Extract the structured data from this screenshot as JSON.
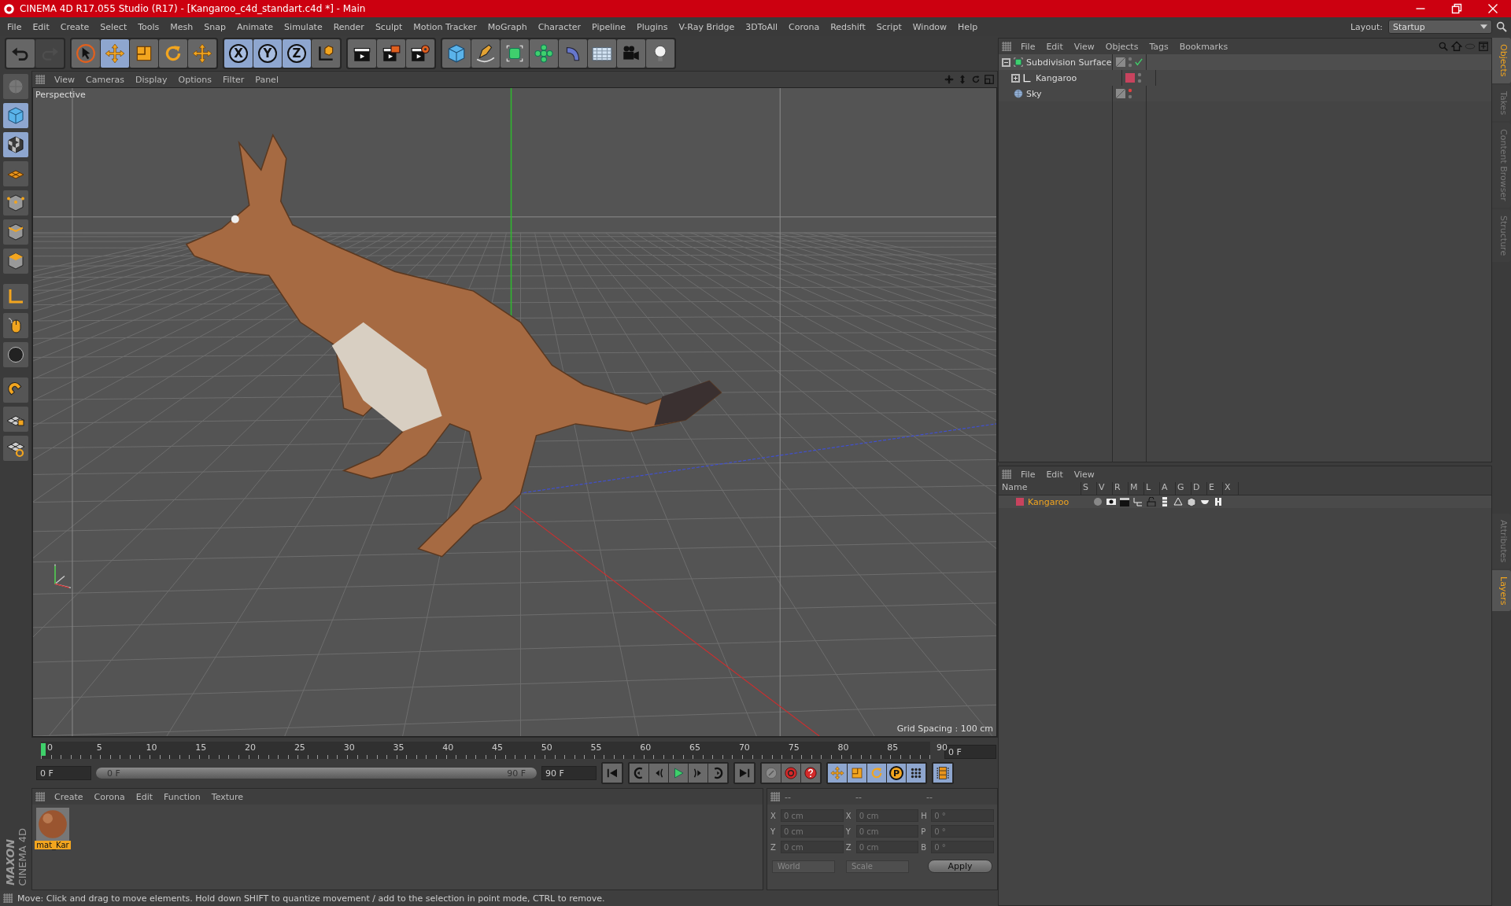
{
  "window": {
    "title": "CINEMA 4D R17.055 Studio (R17) - [Kangaroo_c4d_standart.c4d *] - Main"
  },
  "menu": [
    "File",
    "Edit",
    "Create",
    "Select",
    "Tools",
    "Mesh",
    "Snap",
    "Animate",
    "Simulate",
    "Render",
    "Sculpt",
    "Motion Tracker",
    "MoGraph",
    "Character",
    "Pipeline",
    "Plugins",
    "V-Ray Bridge",
    "3DToAll",
    "Corona",
    "Redshift",
    "Script",
    "Window",
    "Help"
  ],
  "layout": {
    "label": "Layout:",
    "value": "Startup"
  },
  "toolbar": {
    "history": [
      {
        "disabled": false
      },
      {
        "disabled": true
      }
    ],
    "tools": [
      {
        "selected": false
      },
      {
        "selected": true
      },
      {
        "selected": false
      },
      {
        "selected": false
      },
      {
        "selected": false
      }
    ],
    "axes": [
      {
        "label": "X",
        "selected": true
      },
      {
        "label": "Y",
        "selected": true
      },
      {
        "label": "Z",
        "selected": true
      }
    ]
  },
  "left_tools": [
    {
      "selected": false
    },
    {
      "selected": true
    },
    {
      "selected": true
    },
    {
      "selected": false
    },
    {
      "selected": false
    },
    {
      "selected": false
    },
    {
      "selected": false
    },
    {
      "selected": false
    },
    {
      "selected": false
    },
    {
      "selected": false
    },
    {
      "selected": false
    },
    {
      "selected": false
    },
    {
      "selected": false
    }
  ],
  "brand": {
    "line1": "MAXON",
    "line2": "CINEMA 4D"
  },
  "viewport": {
    "menu": [
      "View",
      "Cameras",
      "Display",
      "Options",
      "Filter",
      "Panel"
    ],
    "camera": "Perspective",
    "grid_spacing": "Grid Spacing : 100 cm"
  },
  "timeline": {
    "ticks": [
      "0",
      "5",
      "10",
      "15",
      "20",
      "25",
      "30",
      "35",
      "40",
      "45",
      "50",
      "55",
      "60",
      "65",
      "70",
      "75",
      "80",
      "85",
      "90"
    ],
    "frame": "0 F"
  },
  "transport": {
    "start": "0 F",
    "range": {
      "start": "0 F",
      "end": "90 F",
      "level": 1
    },
    "end": "90 F",
    "key_modes": [
      {
        "selected": true
      },
      {
        "selected": true
      },
      {
        "selected": true
      },
      {
        "label": "P",
        "selected": true
      },
      {
        "selected": true
      }
    ]
  },
  "materials": {
    "menu": [
      "Create",
      "Corona",
      "Edit",
      "Function",
      "Texture"
    ],
    "items": [
      {
        "name": "mat_Kar",
        "selected": true
      }
    ]
  },
  "coordinates": {
    "headers": [
      "--",
      "--",
      "--"
    ],
    "rows": [
      {
        "axis": "X",
        "position": "0 cm",
        "size_axis": "X",
        "size": "0 cm",
        "rot_axis": "H",
        "rotation": "0 °"
      },
      {
        "axis": "Y",
        "position": "0 cm",
        "size_axis": "Y",
        "size": "0 cm",
        "rot_axis": "P",
        "rotation": "0 °"
      },
      {
        "axis": "Z",
        "position": "0 cm",
        "size_axis": "Z",
        "size": "0 cm",
        "rot_axis": "B",
        "rotation": "0 °"
      }
    ],
    "mode": "World",
    "size_mode": "Scale",
    "apply": "Apply"
  },
  "status": "Move: Click and drag to move elements. Hold down SHIFT to quantize movement / add to the selection in point mode, CTRL to remove.",
  "objects": {
    "menu": [
      "File",
      "Edit",
      "View",
      "Objects",
      "Tags",
      "Bookmarks"
    ],
    "tree": [
      {
        "name": "Subdivision Surface",
        "kind": "subdivision",
        "expanded": true,
        "editor_visible": true,
        "enabled": true,
        "children": [
          {
            "name": "Kangaroo",
            "kind": "null",
            "expanded": false,
            "editor_visible": true,
            "color": "#c8435e"
          }
        ]
      },
      {
        "name": "Sky",
        "kind": "sky",
        "editor_visible": false
      }
    ]
  },
  "layers": {
    "menu": [
      "File",
      "Edit",
      "View"
    ],
    "columns": [
      "Name",
      "S",
      "V",
      "R",
      "M",
      "L",
      "A",
      "G",
      "D",
      "E",
      "X"
    ],
    "rows": [
      {
        "name": "Kangaroo",
        "color": "#c8435e"
      }
    ]
  },
  "side_tabs": {
    "top": [
      {
        "label": "Objects",
        "selected": true
      },
      {
        "label": "Takes",
        "selected": false
      },
      {
        "label": "Content Browser",
        "selected": false
      },
      {
        "label": "Structure",
        "selected": false
      }
    ],
    "bottom": [
      {
        "label": "Attributes",
        "selected": false
      },
      {
        "label": "Layers",
        "selected": true
      }
    ]
  }
}
